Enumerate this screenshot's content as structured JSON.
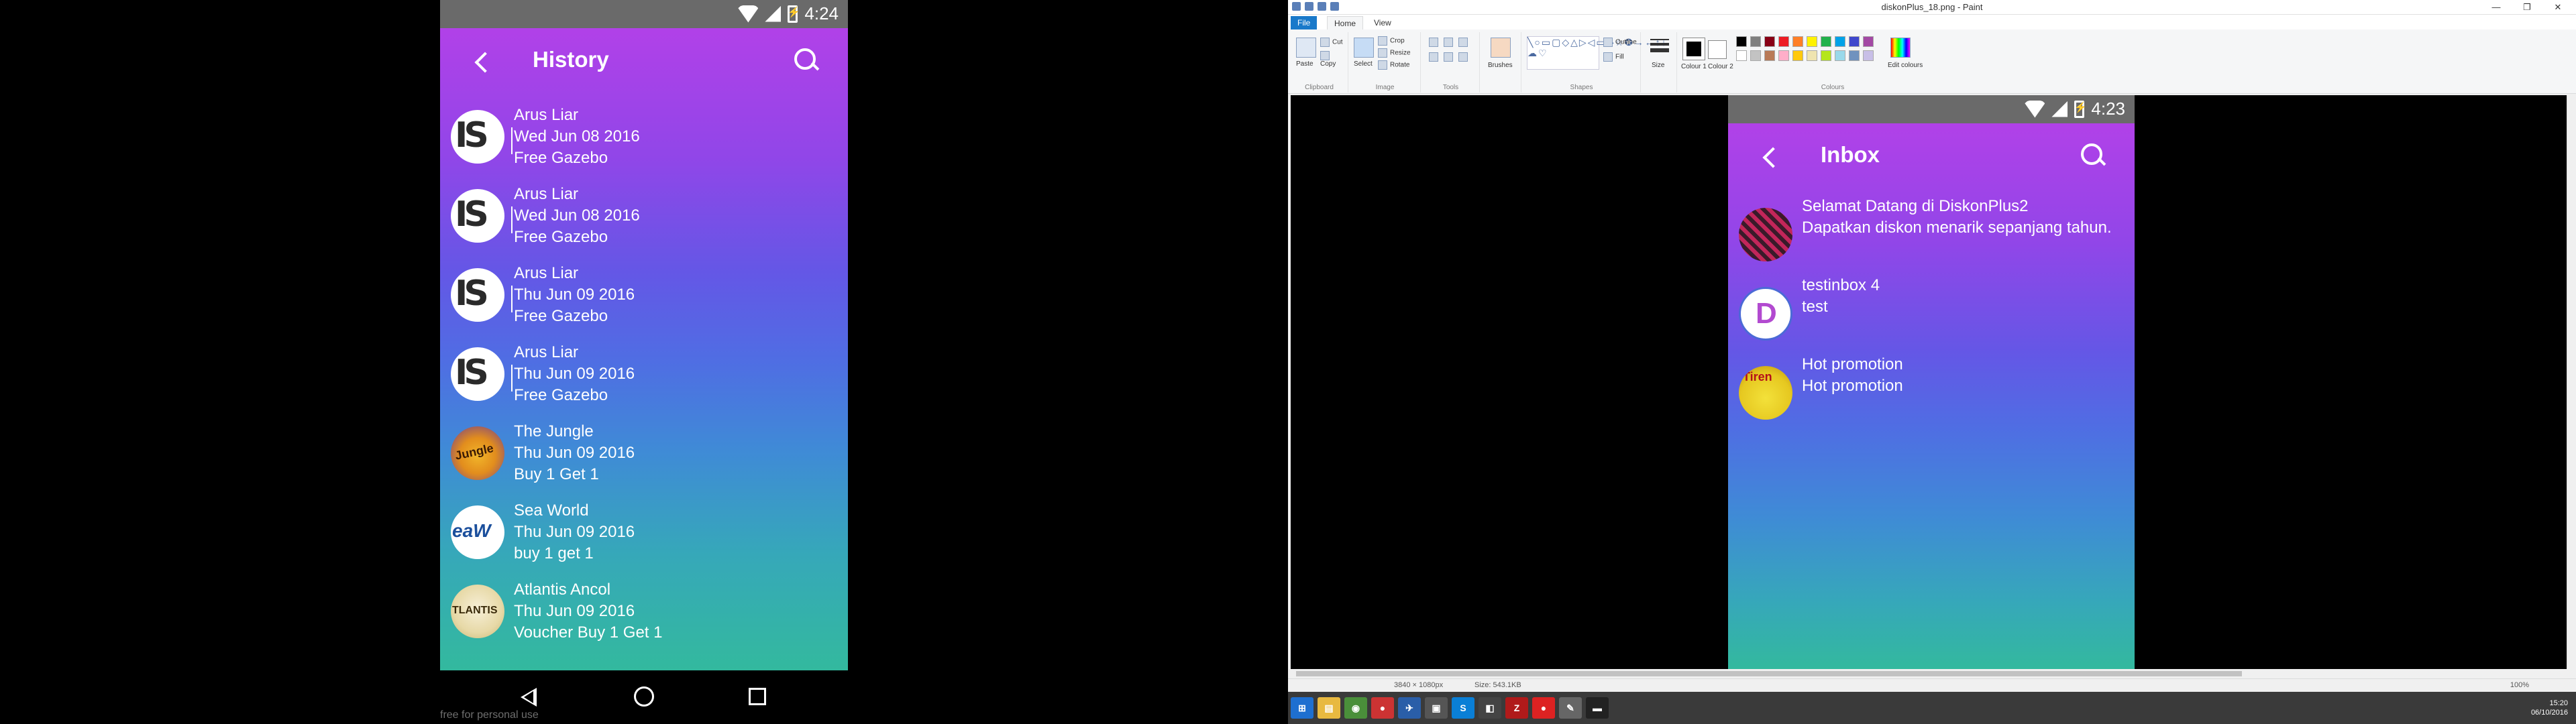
{
  "left_phone": {
    "status": {
      "time": "4:24"
    },
    "appbar": {
      "title": "History"
    },
    "items": [
      {
        "name": "Arus Liar",
        "date": "Wed Jun 08 2016",
        "promo": "Free Gazebo",
        "logo": "arus-liar-logo"
      },
      {
        "name": "Arus Liar",
        "date": "Wed Jun 08 2016",
        "promo": "Free Gazebo",
        "logo": "arus-liar-logo"
      },
      {
        "name": "Arus Liar",
        "date": "Thu Jun 09 2016",
        "promo": "Free Gazebo",
        "logo": "arus-liar-logo"
      },
      {
        "name": "Arus Liar",
        "date": "Thu Jun 09 2016",
        "promo": "Free Gazebo",
        "logo": "arus-liar-logo"
      },
      {
        "name": "The Jungle",
        "date": "Thu Jun 09 2016",
        "promo": "Buy 1 Get 1",
        "logo": "the-jungle-logo"
      },
      {
        "name": "Sea World",
        "date": "Thu Jun 09 2016",
        "promo": "buy 1 get 1",
        "logo": "sea-world-logo"
      },
      {
        "name": "Atlantis Ancol",
        "date": "Thu Jun 09 2016",
        "promo": "Voucher Buy 1 Get 1",
        "logo": "atlantis-logo"
      }
    ],
    "watermark": "free for personal use"
  },
  "paint": {
    "window_title": "diskonPlus_18.png - Paint",
    "tabs": [
      "File",
      "Home",
      "View"
    ],
    "groups": {
      "clipboard": {
        "label": "Clipboard",
        "paste": "Paste",
        "cut": "Cut",
        "copy": "Copy"
      },
      "image": {
        "label": "Image",
        "select": "Select",
        "crop": "Crop",
        "resize": "Resize",
        "rotate": "Rotate"
      },
      "tools": {
        "label": "Tools"
      },
      "brushes": {
        "label": "Brushes"
      },
      "shapes": {
        "label": "Shapes",
        "outline": "Outline",
        "fill": "Fill"
      },
      "size": {
        "label": "Size"
      },
      "colours": {
        "label": "Colours",
        "colour1": "Colour 1",
        "colour2": "Colour 2",
        "edit": "Edit colours"
      }
    },
    "palette": [
      "#000000",
      "#7f7f7f",
      "#880015",
      "#ed1c24",
      "#ff7f27",
      "#fff200",
      "#22b14c",
      "#00a2e8",
      "#3f48cc",
      "#a349a4",
      "#ffffff",
      "#c3c3c3",
      "#b97a57",
      "#ffaec9",
      "#ffc90e",
      "#efe4b0",
      "#b5e61d",
      "#99d9ea",
      "#7092be",
      "#c8bfe7"
    ],
    "statusbar": {
      "dimensions": "3840 × 1080px",
      "size": "Size: 543.1KB",
      "zoom": "100%"
    },
    "tray": {
      "time": "15:20",
      "date": "06/10/2016"
    }
  },
  "right_phone": {
    "status": {
      "time": "4:23"
    },
    "appbar": {
      "title": "Inbox"
    },
    "items": [
      {
        "title": "Selamat Datang di DiskonPlus2",
        "body": "Dapatkan diskon menarik sepanjang tahun.",
        "logo": "selamat-logo"
      },
      {
        "title": "testinbox 4",
        "body": "test",
        "logo": "testinbox-logo"
      },
      {
        "title": "Hot promotion",
        "body": "Hot promotion",
        "logo": "hot-promotion-logo"
      }
    ]
  }
}
